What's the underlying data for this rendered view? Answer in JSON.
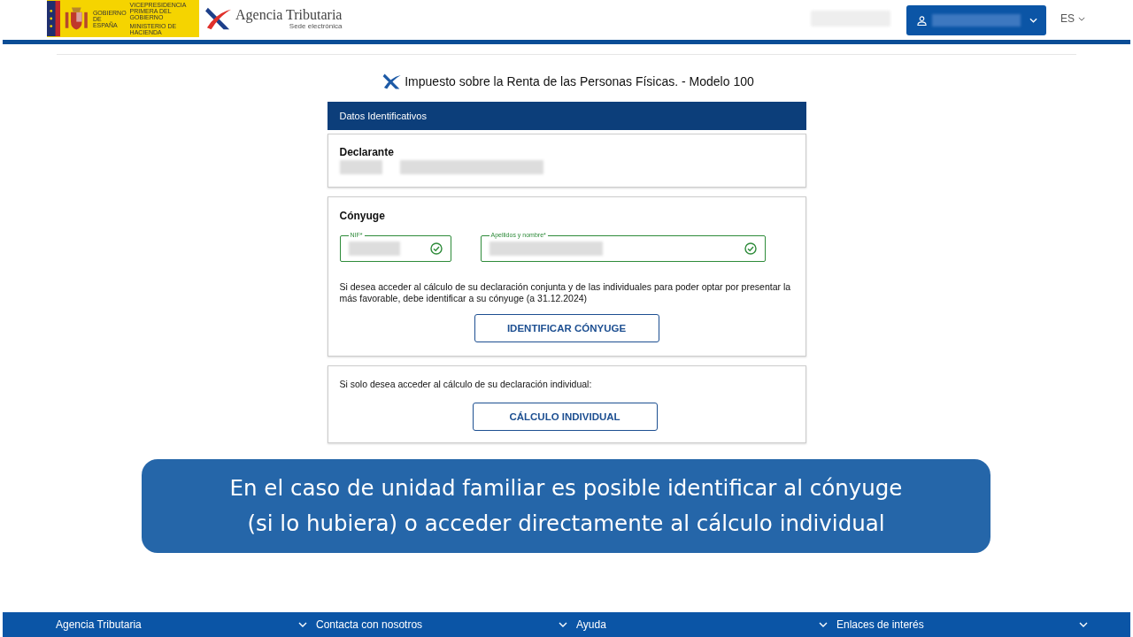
{
  "header": {
    "gov_label": "GOBIERNO DE ESPAÑA",
    "ministry_lines": [
      "VICEPRESIDENCIA PRIMERA DEL GOBIERNO",
      "MINISTERIO DE HACIENDA"
    ],
    "agency_name": "Agencia Tributaria",
    "agency_subtitle": "Sede electrónica",
    "language": "ES"
  },
  "page_title": "Impuesto sobre la Renta de las Personas Físicas. - Modelo 100",
  "section_header": "Datos Identificativos",
  "declarante": {
    "heading": "Declarante"
  },
  "conyuge": {
    "heading": "Cónyuge",
    "fields": [
      {
        "label": "NIF*",
        "valid": true,
        "kind": "short"
      },
      {
        "label": "Apellidos y nombre*",
        "valid": true,
        "kind": "wide"
      }
    ],
    "note": "Si desea acceder al cálculo de su declaración conjunta y de las individuales para poder optar por presentar la más favorable, debe identificar a su cónyuge (a 31.12.2024)",
    "button": "IDENTIFICAR CÓNYUGE"
  },
  "individual": {
    "note": "Si solo desea acceder al cálculo de su declaración individual:",
    "button": "CÁLCULO INDIVIDUAL"
  },
  "caption": [
    "En el caso de unidad familiar es posible identificar al cónyuge",
    "(si lo hubiera) o acceder directamente al cálculo individual"
  ],
  "footer": [
    "Agencia Tributaria",
    "Contacta con nosotros",
    "Ayuda",
    "Enlaces de interés"
  ]
}
